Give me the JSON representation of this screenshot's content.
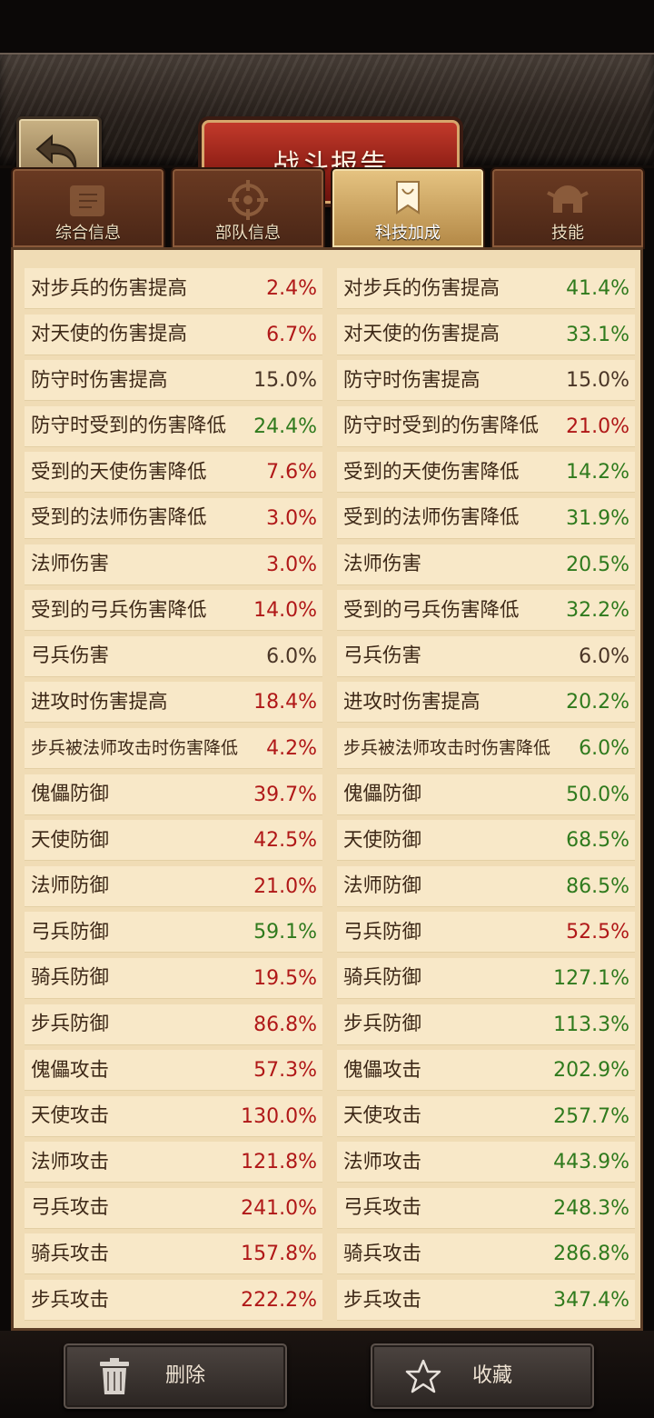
{
  "header": {
    "title": "战斗报告"
  },
  "tabs": [
    {
      "label": "综合信息"
    },
    {
      "label": "部队信息"
    },
    {
      "label": "科技加成"
    },
    {
      "label": "技能"
    }
  ],
  "left_rows": [
    {
      "label": "对步兵的伤害提高",
      "value": "2.4%",
      "color": "#b01818"
    },
    {
      "label": "对天使的伤害提高",
      "value": "6.7%",
      "color": "#b01818"
    },
    {
      "label": "防守时伤害提高",
      "value": "15.0%",
      "color": "#4a3526"
    },
    {
      "label": "防守时受到的伤害降低",
      "value": "24.4%",
      "color": "#2f7a1d"
    },
    {
      "label": "受到的天使伤害降低",
      "value": "7.6%",
      "color": "#b01818"
    },
    {
      "label": "受到的法师伤害降低",
      "value": "3.0%",
      "color": "#b01818"
    },
    {
      "label": "法师伤害",
      "value": "3.0%",
      "color": "#b01818"
    },
    {
      "label": "受到的弓兵伤害降低",
      "value": "14.0%",
      "color": "#b01818"
    },
    {
      "label": "弓兵伤害",
      "value": "6.0%",
      "color": "#4a3526"
    },
    {
      "label": "进攻时伤害提高",
      "value": "18.4%",
      "color": "#b01818"
    },
    {
      "label": "步兵被法师攻击时伤害降低",
      "value": "4.2%",
      "color": "#b01818"
    },
    {
      "label": "傀儡防御",
      "value": "39.7%",
      "color": "#b01818"
    },
    {
      "label": "天使防御",
      "value": "42.5%",
      "color": "#b01818"
    },
    {
      "label": "法师防御",
      "value": "21.0%",
      "color": "#b01818"
    },
    {
      "label": "弓兵防御",
      "value": "59.1%",
      "color": "#2f7a1d"
    },
    {
      "label": "骑兵防御",
      "value": "19.5%",
      "color": "#b01818"
    },
    {
      "label": "步兵防御",
      "value": "86.8%",
      "color": "#b01818"
    },
    {
      "label": "傀儡攻击",
      "value": "57.3%",
      "color": "#b01818"
    },
    {
      "label": "天使攻击",
      "value": "130.0%",
      "color": "#b01818"
    },
    {
      "label": "法师攻击",
      "value": "121.8%",
      "color": "#b01818"
    },
    {
      "label": "弓兵攻击",
      "value": "241.0%",
      "color": "#b01818"
    },
    {
      "label": "骑兵攻击",
      "value": "157.8%",
      "color": "#b01818"
    },
    {
      "label": "步兵攻击",
      "value": "222.2%",
      "color": "#b01818"
    }
  ],
  "right_rows": [
    {
      "label": "对步兵的伤害提高",
      "value": "41.4%",
      "color": "#2f7a1d"
    },
    {
      "label": "对天使的伤害提高",
      "value": "33.1%",
      "color": "#2f7a1d"
    },
    {
      "label": "防守时伤害提高",
      "value": "15.0%",
      "color": "#4a3526"
    },
    {
      "label": "防守时受到的伤害降低",
      "value": "21.0%",
      "color": "#b01818"
    },
    {
      "label": "受到的天使伤害降低",
      "value": "14.2%",
      "color": "#2f7a1d"
    },
    {
      "label": "受到的法师伤害降低",
      "value": "31.9%",
      "color": "#2f7a1d"
    },
    {
      "label": "法师伤害",
      "value": "20.5%",
      "color": "#2f7a1d"
    },
    {
      "label": "受到的弓兵伤害降低",
      "value": "32.2%",
      "color": "#2f7a1d"
    },
    {
      "label": "弓兵伤害",
      "value": "6.0%",
      "color": "#4a3526"
    },
    {
      "label": "进攻时伤害提高",
      "value": "20.2%",
      "color": "#2f7a1d"
    },
    {
      "label": "步兵被法师攻击时伤害降低",
      "value": "6.0%",
      "color": "#2f7a1d"
    },
    {
      "label": "傀儡防御",
      "value": "50.0%",
      "color": "#2f7a1d"
    },
    {
      "label": "天使防御",
      "value": "68.5%",
      "color": "#2f7a1d"
    },
    {
      "label": "法师防御",
      "value": "86.5%",
      "color": "#2f7a1d"
    },
    {
      "label": "弓兵防御",
      "value": "52.5%",
      "color": "#b01818"
    },
    {
      "label": "骑兵防御",
      "value": "127.1%",
      "color": "#2f7a1d"
    },
    {
      "label": "步兵防御",
      "value": "113.3%",
      "color": "#2f7a1d"
    },
    {
      "label": "傀儡攻击",
      "value": "202.9%",
      "color": "#2f7a1d"
    },
    {
      "label": "天使攻击",
      "value": "257.7%",
      "color": "#2f7a1d"
    },
    {
      "label": "法师攻击",
      "value": "443.9%",
      "color": "#2f7a1d"
    },
    {
      "label": "弓兵攻击",
      "value": "248.3%",
      "color": "#2f7a1d"
    },
    {
      "label": "骑兵攻击",
      "value": "286.8%",
      "color": "#2f7a1d"
    },
    {
      "label": "步兵攻击",
      "value": "347.4%",
      "color": "#2f7a1d"
    }
  ],
  "bottom": {
    "delete_label": "删除",
    "favorite_label": "收藏"
  }
}
